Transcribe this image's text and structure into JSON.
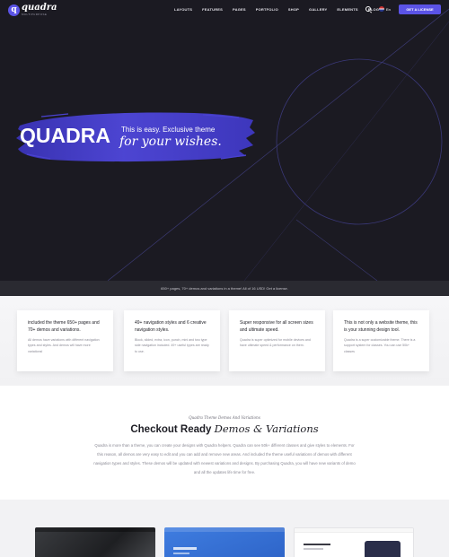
{
  "brand": {
    "name": "quadra",
    "tagline": "MULTIPURPOSE",
    "mark": "q"
  },
  "nav": {
    "items": [
      "LAYOUTS",
      "FEATURES",
      "PAGES",
      "PORTFOLIO",
      "SHOP",
      "GALLERY",
      "ELEMENTS",
      "BLOG"
    ],
    "lang": "En",
    "cta": "GET A LICENSE"
  },
  "hero": {
    "title": "QUADRA",
    "tagline_top": "This is easy. Exclusive theme",
    "tagline_script": "for your wishes."
  },
  "strip": {
    "text": "650+ pages, 70+ demos and variations in a theme! All of 16 USD! Get a license."
  },
  "features": [
    {
      "title": "included the theme 650+ pages and 70+ demos and variations.",
      "body": "All demos have variations with different navigation types and styles. And demos will have more variations!"
    },
    {
      "title": "49+ navigation styles and 6 creative navigation styles.",
      "body": "Block, slided, extra, icon, punch, mini and two type side navigation included. 49+ useful types are ready to use."
    },
    {
      "title": "Super responsive for all screen sizes and ultimate speed.",
      "body": "Quadra is super optimized for mobile devices and have ultimate speed & performance on them."
    },
    {
      "title": "This is not only a website theme, this is your stunning design tool.",
      "body": "Quadra is a super customizable theme. There is a support system for classes. You can use 50k+ classes"
    }
  ],
  "checkout": {
    "eyebrow": "Quadra Theme Demos And Variations",
    "headline_bold": "Checkout Ready",
    "headline_italic": "Demos & Variations",
    "body": "Quadra is more than a theme, you can create your designs with Quadra helpers. Quadra can see 50k+ different classes and give styles to elements. For this reason, all demos are very easy to edit and you can add and remove new areas. And included the theme useful variations of demos with different navigation types and styles. These demos will be updated with newest variations and designs. By purchasing Quadra, you will have new variants of demo and all the updates life time for free."
  },
  "colors": {
    "accent": "#5b53e6",
    "hero_bg": "#1b1a22",
    "strip_bg": "#2a2a31"
  }
}
